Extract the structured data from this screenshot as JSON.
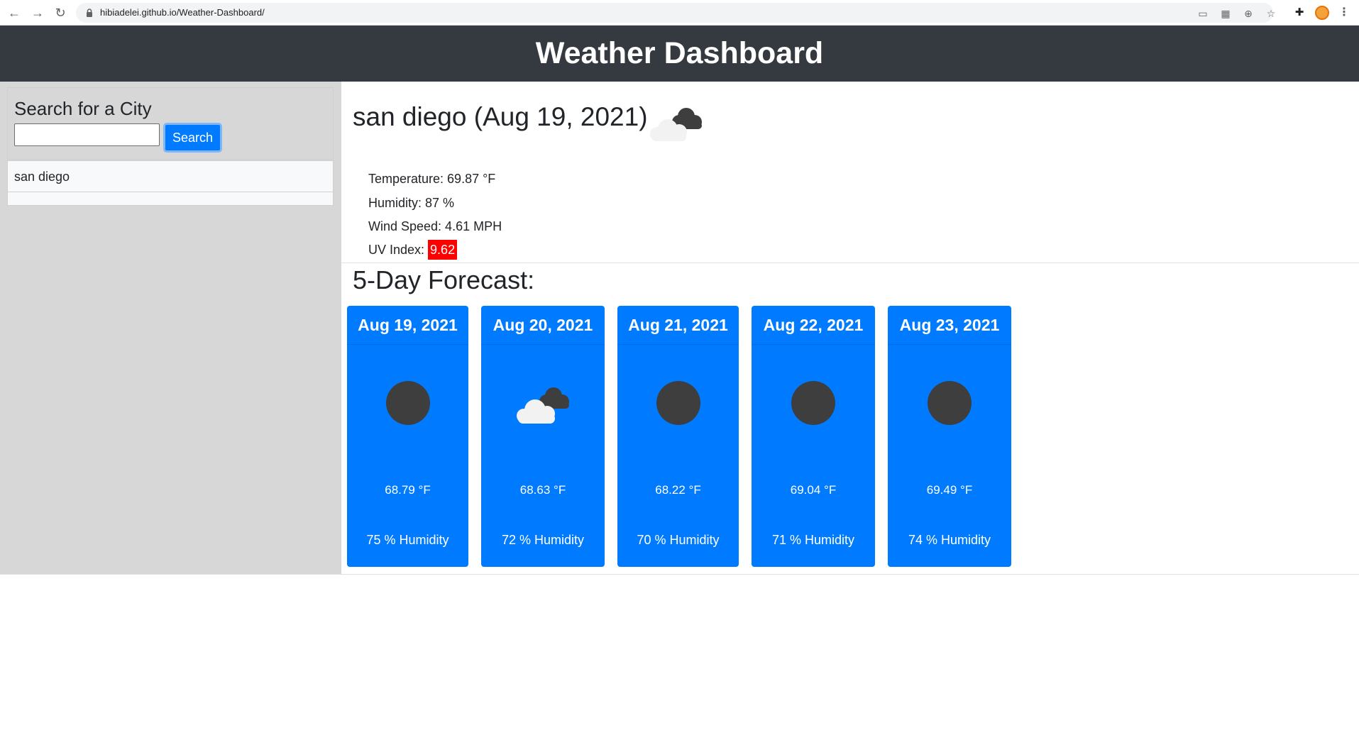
{
  "browser": {
    "url": "hibiadelei.github.io/Weather-Dashboard/"
  },
  "header": {
    "title": "Weather Dashboard"
  },
  "sidebar": {
    "heading": "Search for a City",
    "search_value": "",
    "search_button": "Search",
    "history": [
      "san diego"
    ]
  },
  "current": {
    "title": "san diego (Aug 19, 2021)",
    "icon": "clouds-icon",
    "temperature": "Temperature: 69.87 °F",
    "humidity": "Humidity: 87 %",
    "wind": "Wind Speed: 4.61 MPH",
    "uv_label": "UV Index: ",
    "uv_value": "9.62",
    "uv_color": "#ff0000"
  },
  "forecast": {
    "title": "5-Day Forecast:",
    "days": [
      {
        "date": "Aug 19, 2021",
        "icon": "dark-circle-icon",
        "temp": "68.79 °F",
        "humidity": "75 % Humidity"
      },
      {
        "date": "Aug 20, 2021",
        "icon": "clouds-icon",
        "temp": "68.63 °F",
        "humidity": "72 % Humidity"
      },
      {
        "date": "Aug 21, 2021",
        "icon": "dark-circle-icon",
        "temp": "68.22 °F",
        "humidity": "70 % Humidity"
      },
      {
        "date": "Aug 22, 2021",
        "icon": "dark-circle-icon",
        "temp": "69.04 °F",
        "humidity": "71 % Humidity"
      },
      {
        "date": "Aug 23, 2021",
        "icon": "dark-circle-icon",
        "temp": "69.49 °F",
        "humidity": "74 % Humidity"
      }
    ]
  },
  "colors": {
    "header_bg": "#343a40",
    "sidebar_bg": "#d7d7d7",
    "accent": "#007bff"
  }
}
